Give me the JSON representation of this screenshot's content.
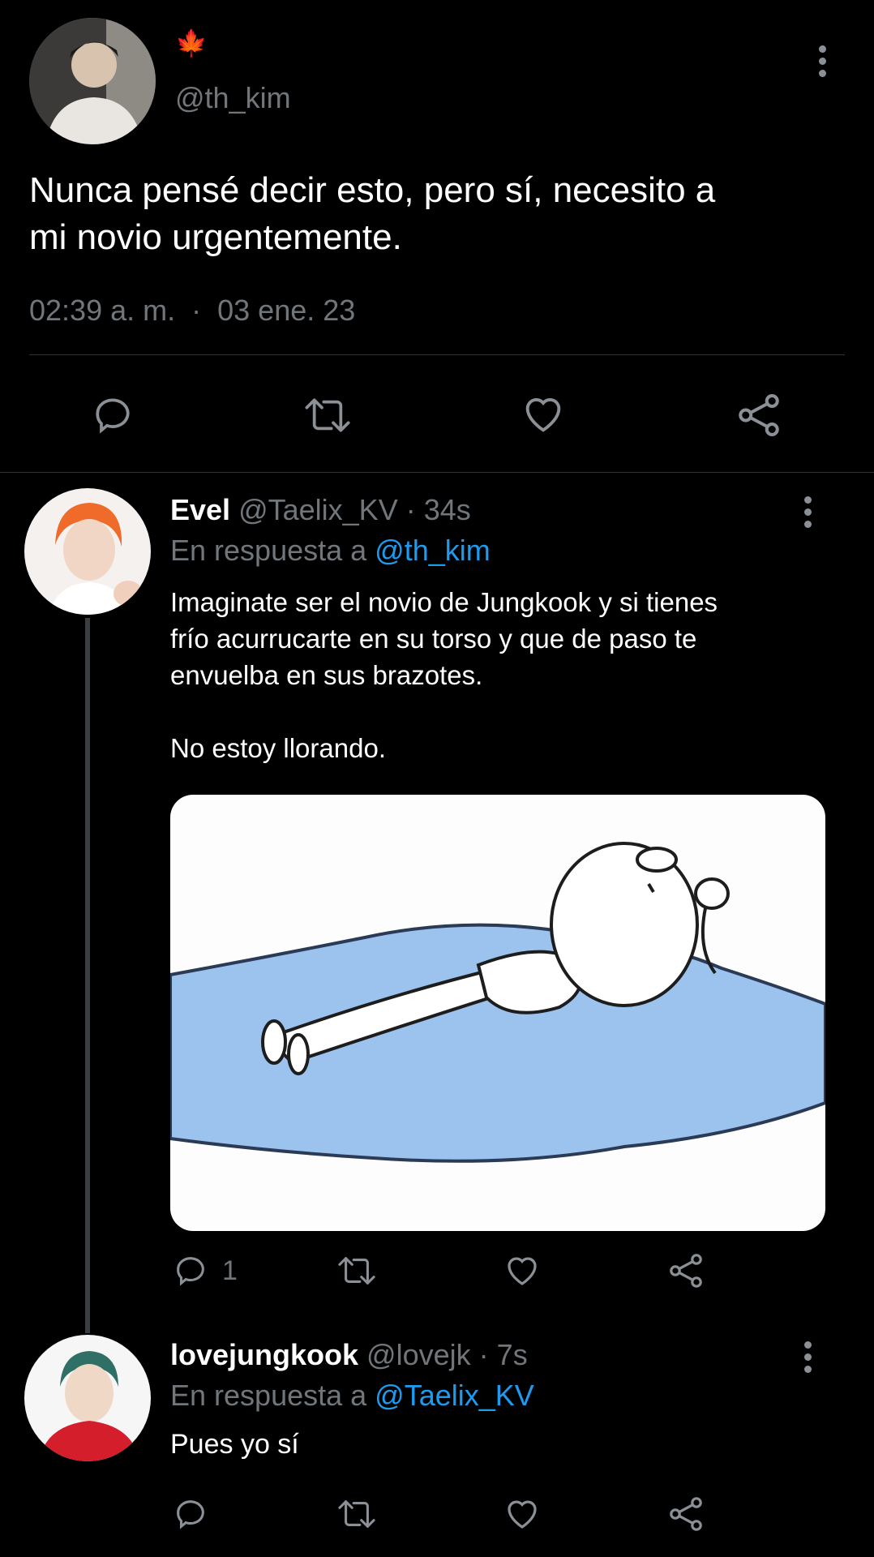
{
  "main_tweet": {
    "badge": "🍁",
    "handle": "@th_kim",
    "text_line1": "Nunca pensé decir esto, pero sí, necesito a",
    "text_line2": "mi novio urgentemente.",
    "time": "02:39 a. m.",
    "separator": "·",
    "date": "03 ene. 23"
  },
  "reply1": {
    "name": "Evel",
    "handle": "@Taelix_KV",
    "dot": "·",
    "age": "34s",
    "reply_prefix": "En respuesta a",
    "reply_to": "@th_kim",
    "text_line1": "Imaginate ser el novio de Jungkook y si tienes",
    "text_line2": "frío acurrucarte en su torso  y que de paso te",
    "text_line3": "envuelba en sus brazotes.",
    "text_line4": "No estoy llorando.",
    "reply_count": "1"
  },
  "reply2": {
    "name": "lovejungkook",
    "handle": "@lovejk",
    "dot": "·",
    "age": "7s",
    "reply_prefix": "En respuesta a",
    "reply_to": "@Taelix_KV",
    "text": "Pues yo sí"
  },
  "colors": {
    "background": "#000000",
    "text": "#e7e9ea",
    "muted": "#71767b",
    "link": "#1d9bf0",
    "divider": "#2f3336"
  },
  "icons": [
    "more-icon",
    "reply-icon",
    "retweet-icon",
    "like-icon",
    "share-icon"
  ]
}
